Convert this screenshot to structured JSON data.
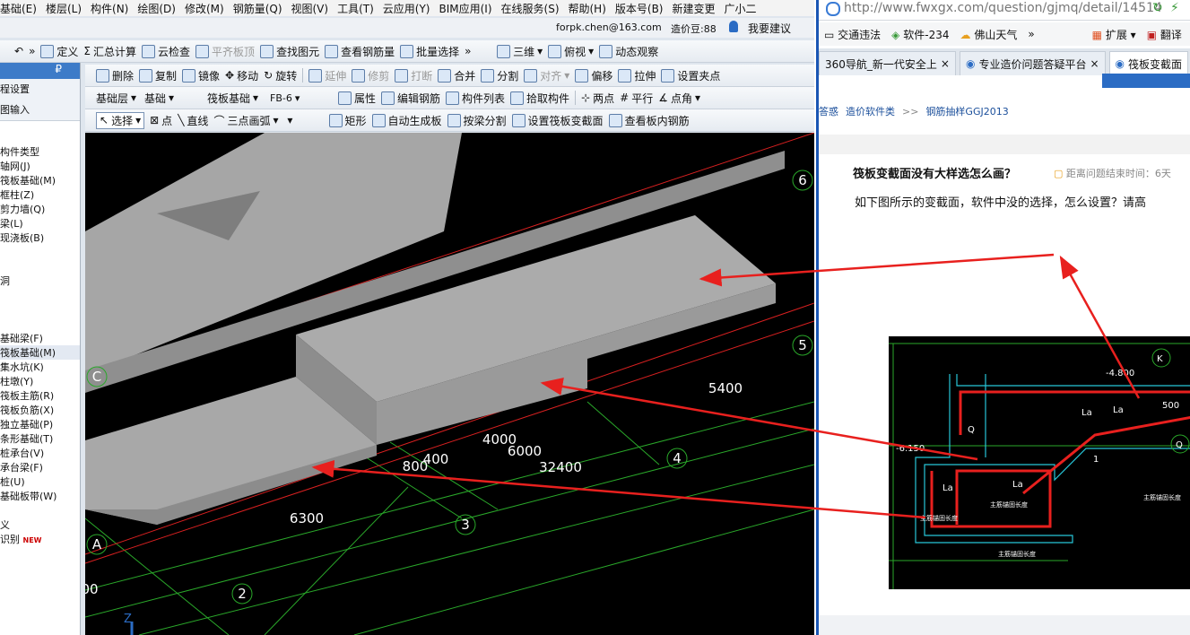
{
  "menu": [
    "基础(E)",
    "楼层(L)",
    "构件(N)",
    "绘图(D)",
    "修改(M)",
    "钢筋量(Q)",
    "视图(V)",
    "工具(T)",
    "云应用(Y)",
    "BIM应用(I)",
    "在线服务(S)",
    "帮助(H)",
    "版本号(B)",
    "新建变更",
    "广小二"
  ],
  "account": {
    "email": "forpk.chen@163.com",
    "balance_label": "造价豆:88",
    "suggest": "我要建议"
  },
  "toolbar1": {
    "define": "定义",
    "sum": "汇总计算",
    "cloud_check": "云检查",
    "flat_top": "平齐板顶",
    "find": "查找图元",
    "view_rebar": "查看钢筋量",
    "batch_select": "批量选择",
    "three_d": "三维",
    "top_view": "俯视",
    "dynamic": "动态观察"
  },
  "toolbar2": {
    "delete": "删除",
    "copy": "复制",
    "mirror": "镜像",
    "move": "移动",
    "rotate": "旋转",
    "extend": "延伸",
    "trim": "修剪",
    "break": "打断",
    "merge": "合并",
    "split": "分割",
    "align": "对齐",
    "offset": "偏移",
    "stretch": "拉伸",
    "set_point": "设置夹点"
  },
  "toolbar3": {
    "layer": "基础层",
    "layer_type": "基础",
    "component_type": "筏板基础",
    "component": "FB-6",
    "props": "属性",
    "edit_rebar": "编辑钢筋",
    "component_list": "构件列表",
    "pick": "拾取构件",
    "two_points": "两点",
    "parallel": "平行",
    "point_angle": "点角"
  },
  "toolbar4": {
    "select": "选择",
    "point": "点",
    "line": "直线",
    "arc3": "三点画弧",
    "rect": "矩形",
    "auto_gen": "自动生成板",
    "split_by_beam": "按梁分割",
    "set_var_section": "设置筏板变截面",
    "view_inner_rebar": "查看板内钢筋"
  },
  "left_panel": {
    "top_items": [
      "程设置",
      "图输入"
    ],
    "list": [
      "构件类型",
      "轴网(J)",
      "筏板基础(M)",
      "框柱(Z)",
      "剪力墙(Q)",
      "梁(L)",
      "现浇板(B)",
      "",
      "",
      "洞",
      "",
      "",
      "",
      "基础梁(F)",
      "筏板基础(M)",
      "集水坑(K)",
      "柱墩(Y)",
      "筏板主筋(R)",
      "筏板负筋(X)",
      "独立基础(P)",
      "条形基础(T)",
      "桩承台(V)",
      "承台梁(F)",
      "桩(U)",
      "基础板带(W)",
      "",
      "义",
      "识别"
    ],
    "new_badge": "NEW"
  },
  "canvas": {
    "dims": [
      "5400",
      "4000",
      "6000",
      "800",
      "400",
      "32400",
      "6300",
      "00"
    ],
    "axis_labels": [
      "6",
      "5",
      "4",
      "3",
      "2",
      "A",
      "C"
    ],
    "z_label": "Z"
  },
  "browser": {
    "url": "http://www.fwxgx.com/question/gjmq/detail/14514",
    "favorites": [
      "交通违法",
      "软件-234",
      "佛山天气",
      "扩展",
      "翻译"
    ],
    "tabs": [
      "360导航_新一代安全上",
      "专业造价问题答疑平台",
      "筏板变截面"
    ],
    "breadcrumb": [
      "答惑",
      "造价软件类",
      "钢筋抽样GGJ2013"
    ],
    "question_title": "筏板变截面没有大样选怎么画？",
    "deadline": "距离问题结束时间：6天",
    "question_body": "如下图所示的变截面，软件中没的选择，怎么设置？请高",
    "figure": {
      "labels": [
        "-4.800",
        "500",
        "La",
        "La",
        "Q",
        "-6.150",
        "La",
        "La",
        "主筋锚固长度",
        "主筋锚固长度",
        "主筋锚固长度",
        "主筋锚固长度",
        "1",
        "K",
        "Q"
      ]
    }
  },
  "colors": {
    "accent": "#1a56b4",
    "annot_red": "#e8201e",
    "grid_green": "#2aa82a",
    "grid_red": "#d82020"
  }
}
